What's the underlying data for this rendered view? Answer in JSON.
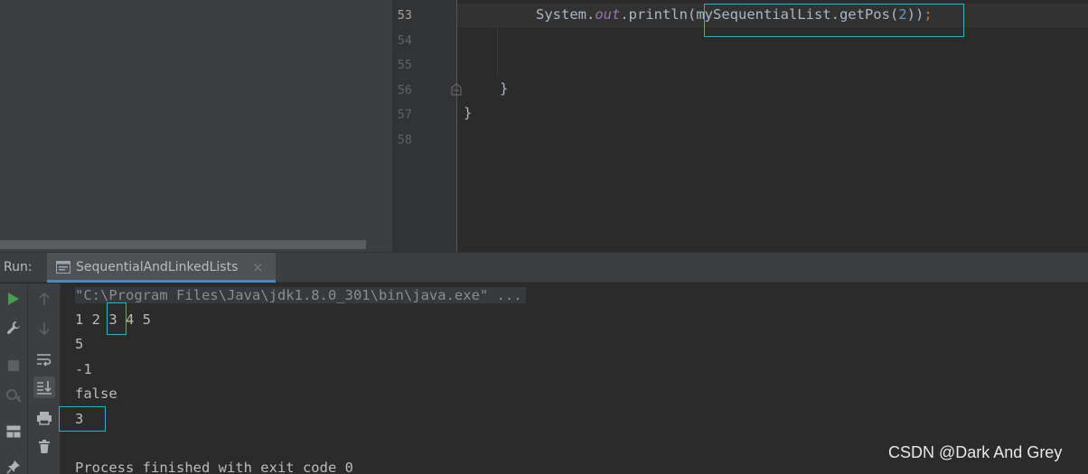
{
  "editor": {
    "line_numbers": [
      "53",
      "54",
      "55",
      "56",
      "57",
      "58"
    ],
    "active_line": "53",
    "code_line_53": {
      "indent": "        ",
      "receiver": "System.",
      "field": "out",
      "call": ".println(",
      "arg_object": "mySequentialList.getPos(",
      "arg_number": "2",
      "close": "))",
      "semicolon": ";"
    },
    "code_line_56": "}",
    "code_line_57": "}"
  },
  "run_window": {
    "label": "Run:",
    "tab_title": "SequentialAndLinkedLists",
    "tab_close": "×",
    "console": {
      "command": "\"C:\\Program Files\\Java\\jdk1.8.0_301\\bin\\java.exe\" ...",
      "output_line_1_pre": "1 2 ",
      "output_line_1_mid": "3",
      "output_line_1_post": " 4 5",
      "output_line_2": "5",
      "output_line_3": "-1",
      "output_line_4": "false",
      "output_line_5": "3",
      "finish_line": "Process finished with exit code 0"
    },
    "toolbar_icons": [
      "run-icon",
      "wrench-icon",
      "stop-icon",
      "debug-settings-icon",
      "layout-icon",
      "pin-icon",
      "up-arrow-icon",
      "down-arrow-icon",
      "soft-wrap-icon",
      "scroll-to-end-icon",
      "print-icon",
      "trash-icon"
    ]
  },
  "watermark": "CSDN @Dark And Grey",
  "colors": {
    "highlight_box": "#27b4c4",
    "run_green": "#499c54",
    "tab_underline": "#4a88c7"
  }
}
